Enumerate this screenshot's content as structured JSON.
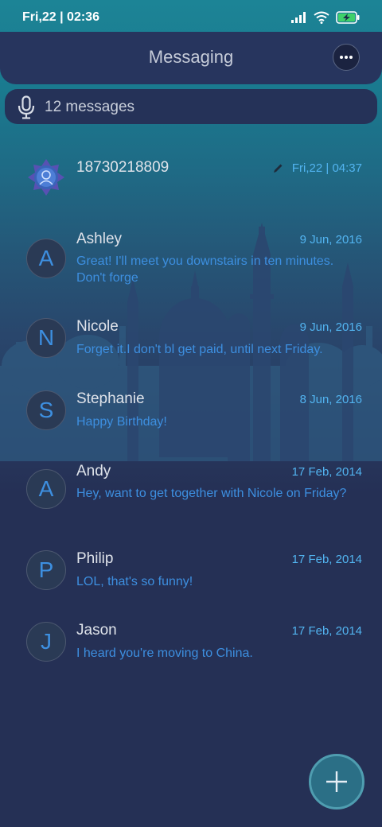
{
  "status_bar": {
    "time": "Fri,22 | 02:36",
    "icons": [
      "signal-icon",
      "wifi-icon",
      "battery-charging-icon"
    ]
  },
  "header": {
    "title": "Messaging",
    "more_icon": "more-icon"
  },
  "search": {
    "icon": "microphone-icon",
    "text": "12 messages"
  },
  "messages": [
    {
      "initial": "",
      "name": "18730218809",
      "date": "Fri,22 | 04:37",
      "preview": "",
      "draft": true
    },
    {
      "initial": "A",
      "name": "Ashley",
      "date": "9 Jun, 2016",
      "preview": "Great! I'll meet you downstairs in ten minutes. Don't forge"
    },
    {
      "initial": "N",
      "name": "Nicole",
      "date": "9 Jun, 2016",
      "preview": "Forget it.I don't bl get paid, until next Friday."
    },
    {
      "initial": "S",
      "name": "Stephanie",
      "date": "8 Jun, 2016",
      "preview": "Happy Birthday!"
    },
    {
      "initial": "A",
      "name": "Andy",
      "date": "17 Feb, 2014",
      "preview": "Hey, want to get together with Nicole on Friday?"
    },
    {
      "initial": "P",
      "name": "Philip",
      "date": "17 Feb, 2014",
      "preview": "LOL, that's so funny!"
    },
    {
      "initial": "J",
      "name": "Jason",
      "date": "17 Feb, 2014",
      "preview": "I heard you're moving to China."
    }
  ],
  "fab": {
    "icon": "plus-icon"
  },
  "colors": {
    "background": "#253055",
    "teal_top": "#1c8496",
    "accent_blue": "#3d8fe0",
    "date_blue": "#52b4f0"
  }
}
